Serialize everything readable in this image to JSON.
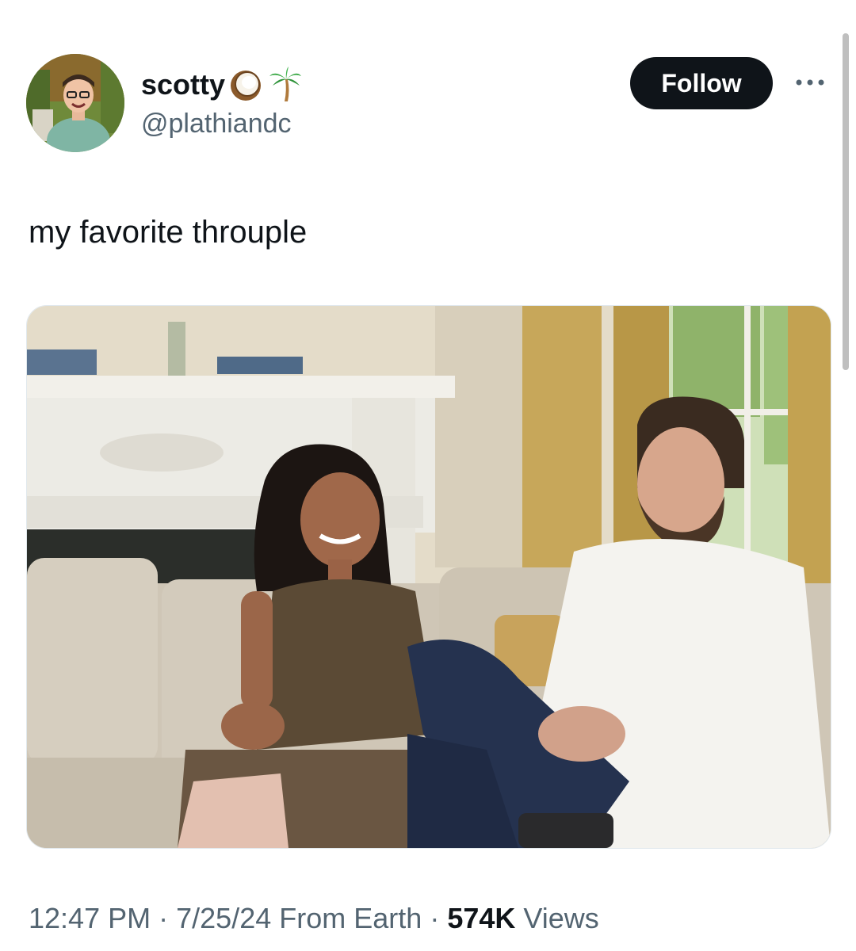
{
  "tweet": {
    "author": {
      "display_name": "scotty",
      "emojis": [
        "coconut-icon",
        "palm-tree-icon"
      ],
      "handle": "@plathiandc"
    },
    "follow_label": "Follow",
    "text": "my favorite throuple",
    "time": "12:47 PM",
    "date": "7/25/24",
    "source": "From Earth",
    "separator": "·",
    "views_count": "574K",
    "views_label": "Views"
  },
  "colors": {
    "text_primary": "#0f1419",
    "text_secondary": "#536471",
    "button_bg": "#0f1419",
    "button_text": "#ffffff"
  }
}
